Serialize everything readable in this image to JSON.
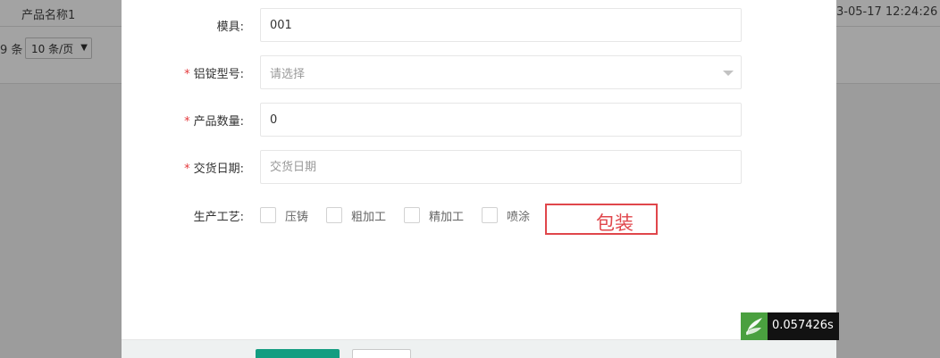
{
  "background": {
    "row": {
      "name": "产品名称1",
      "time": "3-05-17 12:24:26"
    },
    "pager": {
      "total_suffix": "9 条",
      "page_size": "10 条/页"
    }
  },
  "form": {
    "mold": {
      "label": "模具:",
      "value": "001"
    },
    "ingot_model": {
      "label": "铝锭型号:",
      "placeholder": "请选择"
    },
    "quantity": {
      "label": "产品数量:",
      "value": "0"
    },
    "delivery_date": {
      "label": "交货日期:",
      "placeholder": "交货日期"
    },
    "process": {
      "label": "生产工艺:",
      "options": [
        "压铸",
        "粗加工",
        "精加工",
        "喷涂"
      ]
    }
  },
  "annotation": {
    "text": "包装"
  },
  "timing_badge": {
    "value": "0.057426s"
  },
  "colors": {
    "required_mark": "#e4393c",
    "primary_button": "#139d81",
    "annotation": "#e0464b",
    "badge_logo": "#4aa03f"
  },
  "icons": {
    "badge_logo": "leaf-logo-icon",
    "select_caret": "caret-down-icon"
  }
}
